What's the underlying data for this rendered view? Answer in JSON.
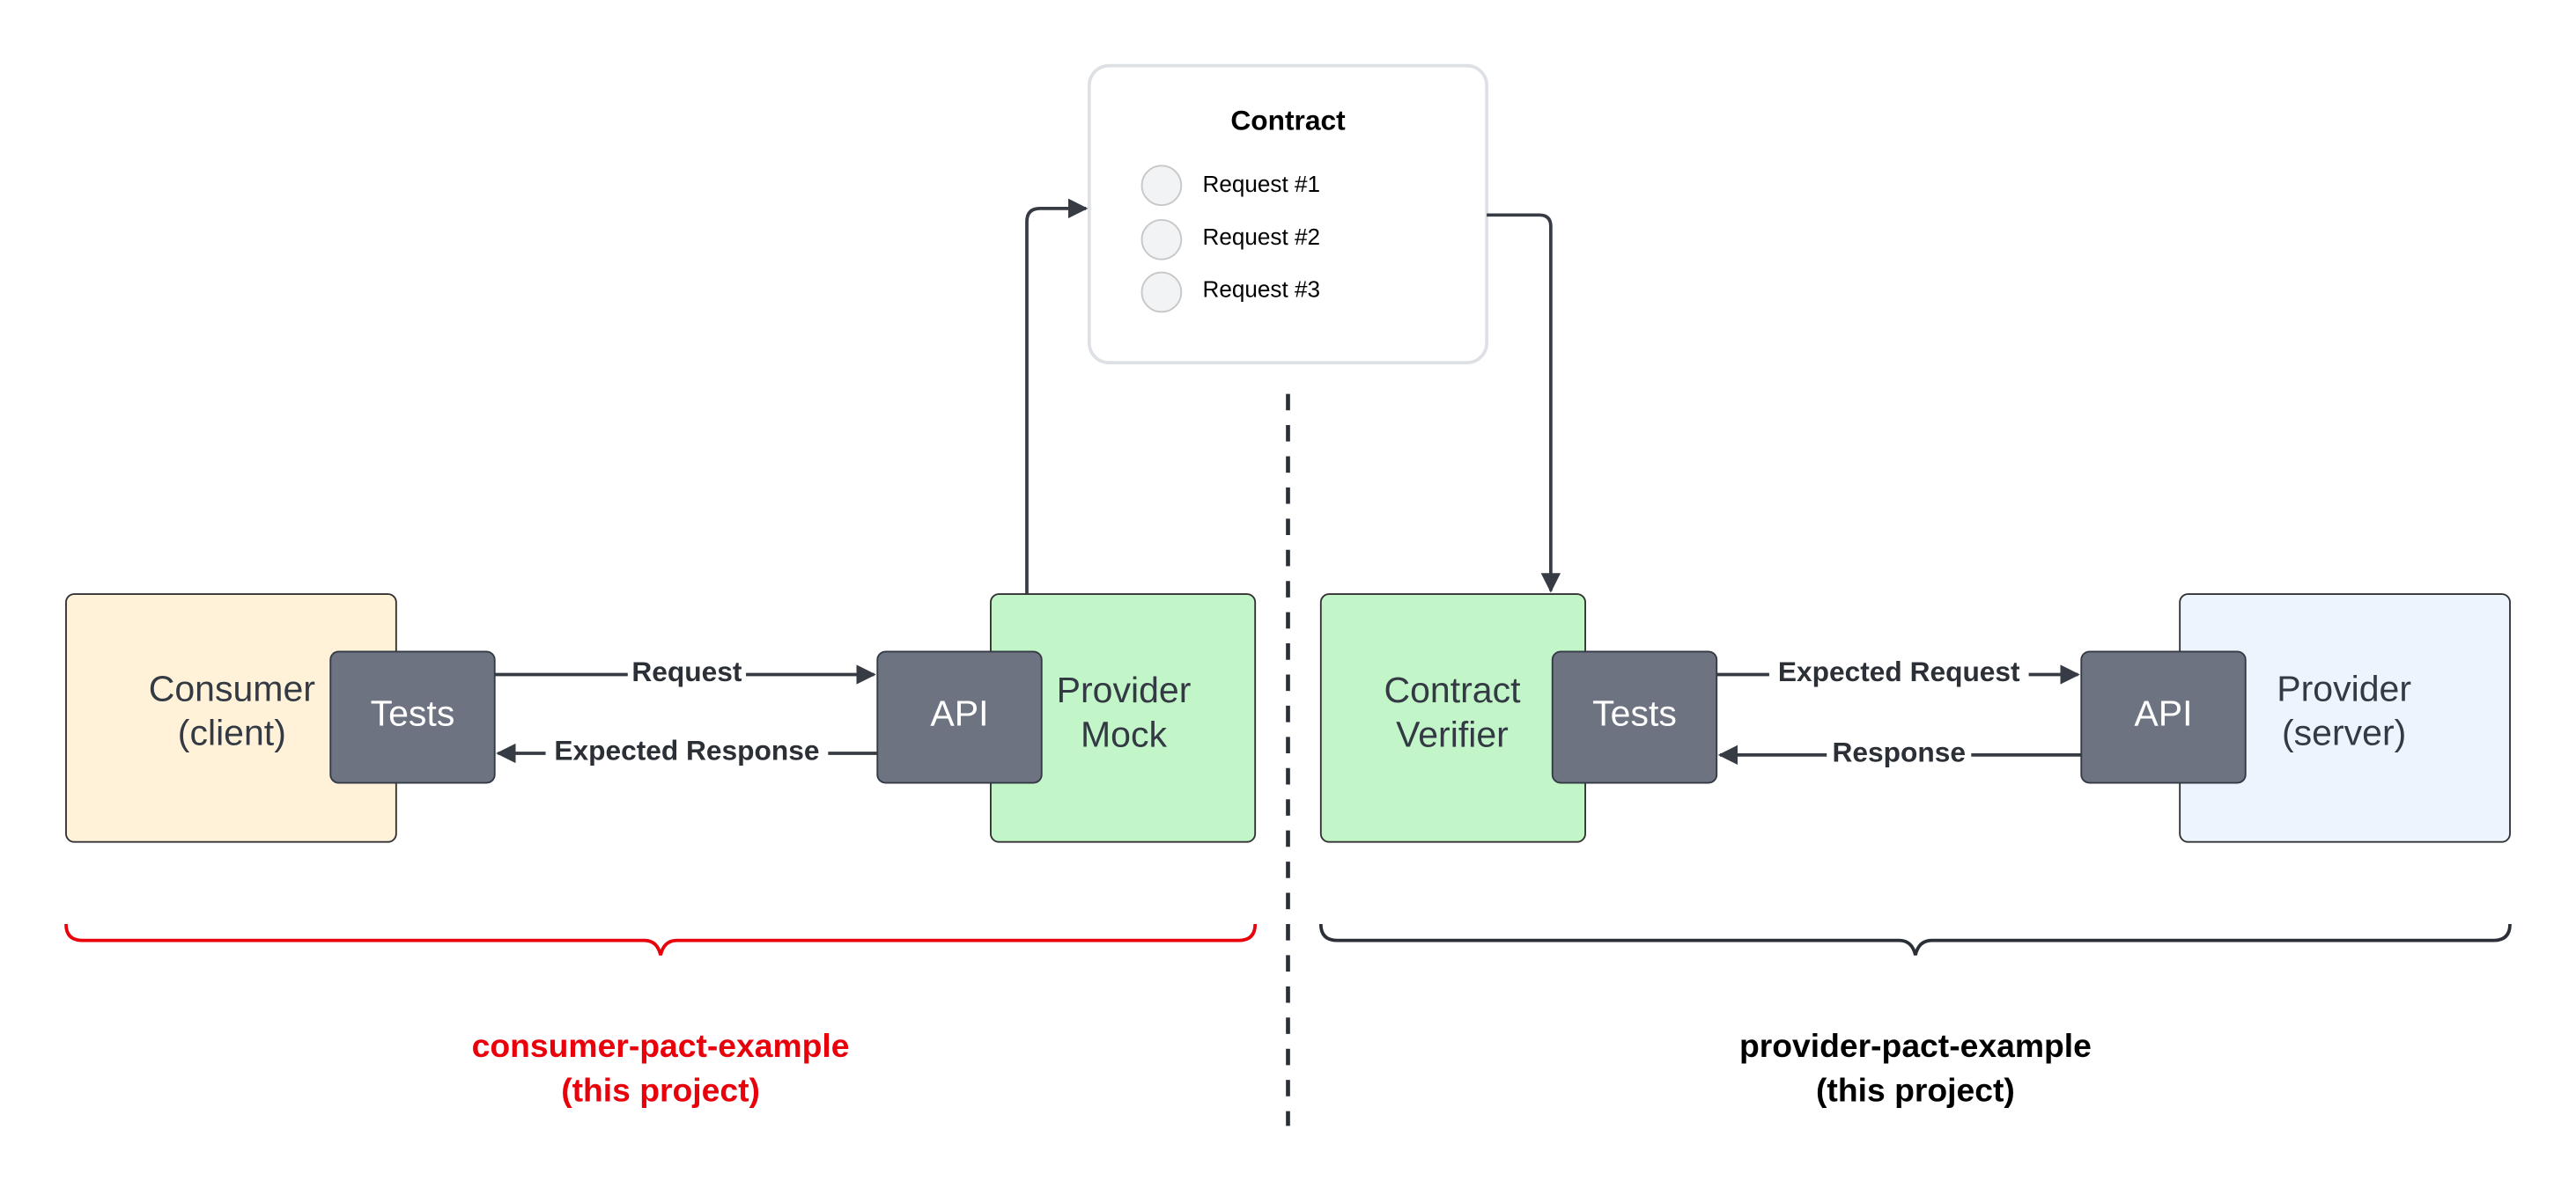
{
  "contract": {
    "title": "Contract",
    "requests": [
      "Request #1",
      "Request #2",
      "Request #3"
    ]
  },
  "consumer_side": {
    "consumer": {
      "line1": "Consumer",
      "line2": "(client)"
    },
    "tests": "Tests",
    "api": "API",
    "provider_mock": {
      "line1": "Provider",
      "line2": "Mock"
    },
    "request_label": "Request",
    "response_label": "Expected Response",
    "project": {
      "line1": "consumer-pact-example",
      "line2": "(this project)"
    }
  },
  "provider_side": {
    "verifier": {
      "line1": "Contract",
      "line2": "Verifier"
    },
    "tests": "Tests",
    "api": "API",
    "provider": {
      "line1": "Provider",
      "line2": "(server)"
    },
    "request_label": "Expected Request",
    "response_label": "Response",
    "project": {
      "line1": "provider-pact-example",
      "line2": "(this project)"
    }
  },
  "colors": {
    "consumer_fill": "#fff2d9",
    "mock_fill": "#c2f5c8",
    "provider_fill": "#edf4fe",
    "component_fill": "#6d7380",
    "consumer_brace": "#e8000b",
    "provider_brace": "#2b2f36"
  }
}
